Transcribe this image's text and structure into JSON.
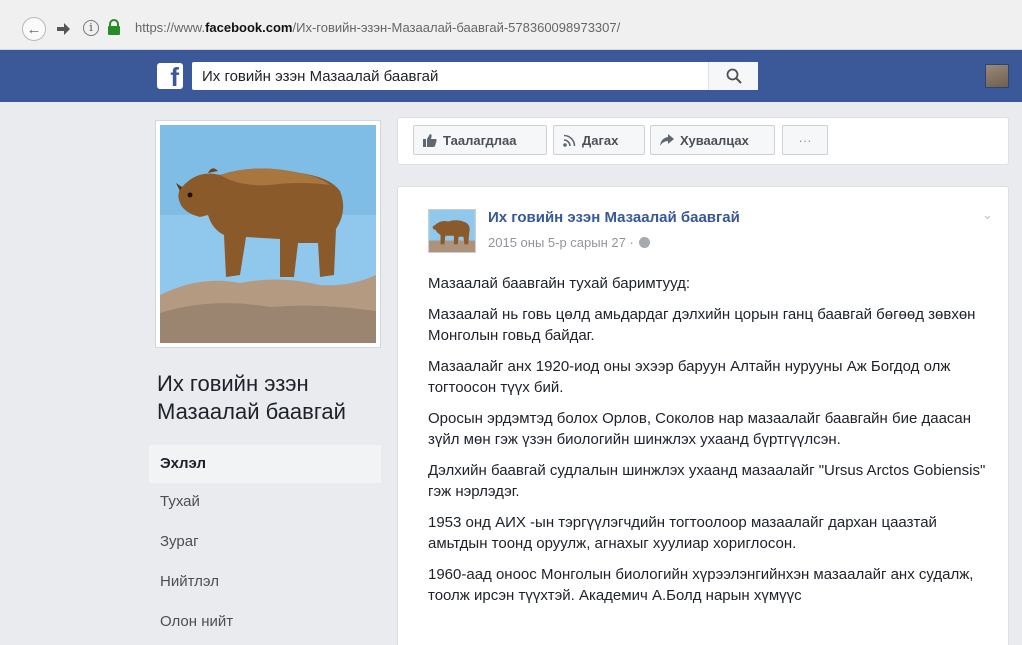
{
  "browser": {
    "url_prefix": "https://www.",
    "url_domain": "facebook.com",
    "url_path": "/Их-говийн-эзэн-Мазаалай-баавгай-578360098973307/"
  },
  "topbar": {
    "search_value": "Их говийн эзэн Мазаалай баавгай"
  },
  "page": {
    "name": "Их говийн эзэн Мазаалай баавгай"
  },
  "left_nav": {
    "items": [
      {
        "label": "Эхлэл",
        "active": true
      },
      {
        "label": "Тухай",
        "active": false
      },
      {
        "label": "Зураг",
        "active": false
      },
      {
        "label": "Нийтлэл",
        "active": false
      },
      {
        "label": "Олон нийт",
        "active": false
      }
    ]
  },
  "actions": {
    "like": "Таалагдлаа",
    "follow": "Дагах",
    "share": "Хуваалцах",
    "more": "···"
  },
  "post": {
    "author": "Их говийн эзэн Мазаалай баавгай",
    "time": "2015 оны 5-р сарын 27 ·",
    "paragraphs": [
      "Мазаалай баавгайн тухай баримтууд:",
      "Мазаалай нь говь цөлд амьдардаг дэлхийн цорын ганц баавгай бөгөөд зөвхөн Монголын говьд байдаг.",
      "Мазаалайг анх 1920-иод оны эхээр баруун Алтайн нурууны Аж Богдод олж тогтоосон түүх бий.",
      "Оросын эрдэмтэд болох Орлов, Соколов нар мазаалайг баавгайн бие даасан зүйл мөн гэж үзэн биологийн шинжлэх ухаанд бүртгүүлсэн.",
      "Дэлхийн баавгай судлалын шинжлэх ухаанд мазаалайг \"Ursus Arctos Gobiensis\" гэж нэрлэдэг.",
      "1953 онд АИХ -ын тэргүүлэгчдийн тогтоолоор мазаалайг дархан цаазтай амьтдын тоонд оруулж, агнахыг хуулиар хориглосон.",
      "1960-аад оноос Монголын биологийн хүрээлэнгийнхэн мазаалайг анх судалж, тоолж ирсэн түүхтэй. Академич А.Болд нарын хүмүүс"
    ]
  }
}
